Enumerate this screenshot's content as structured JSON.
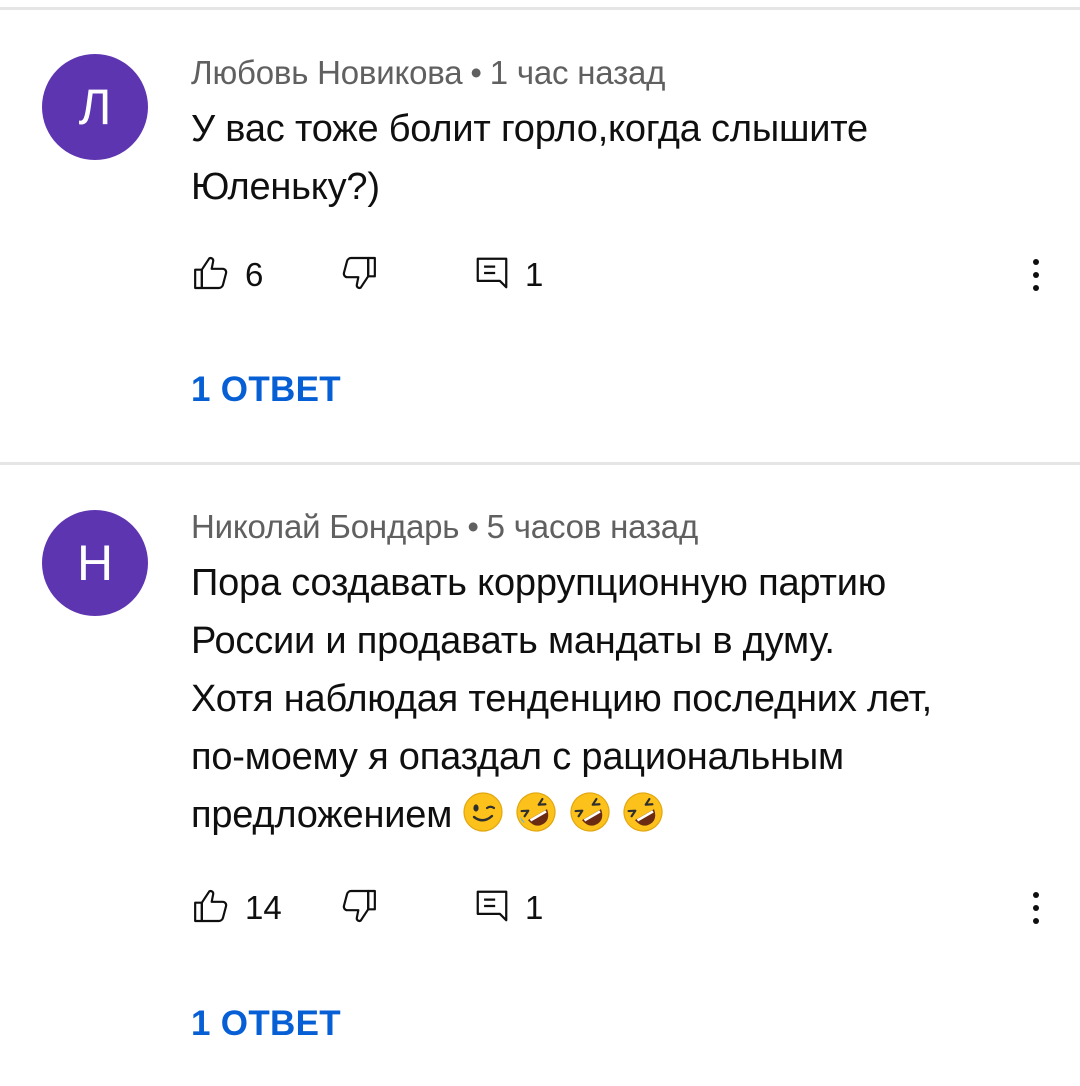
{
  "comments": [
    {
      "avatar_letter": "Л",
      "avatar_color": "#5e35b1",
      "author": "Любовь Новикова",
      "separator": "•",
      "time": "1 час назад",
      "text_lines": [
        "У вас тоже болит горло,когда слышите",
        "Юленьку?)"
      ],
      "likes": "6",
      "replies_count": "1",
      "replies_label": "1 ОТВЕТ"
    },
    {
      "avatar_letter": "Н",
      "avatar_color": "#5e35b1",
      "author": "Николай Бондарь",
      "separator": "•",
      "time": "5 часов назад",
      "text_lines": [
        "Пора создавать коррупционную партию",
        "России и продавать мандаты в думу.",
        "Хотя наблюдая тенденцию последних лет,",
        "по-моему я опаздал с рациональным",
        "предложением"
      ],
      "emojis": [
        "winking-face",
        "rolling-on-floor-laughing",
        "rolling-on-floor-laughing",
        "rolling-on-floor-laughing"
      ],
      "likes": "14",
      "replies_count": "1",
      "replies_label": "1 ОТВЕТ"
    }
  ],
  "icons": {
    "like": "thumb-up-icon",
    "dislike": "thumb-down-icon",
    "reply": "comment-icon",
    "more": "more-vertical-icon"
  },
  "colors": {
    "link": "#065fd4",
    "meta": "#606060",
    "divider": "#e5e5e5"
  }
}
